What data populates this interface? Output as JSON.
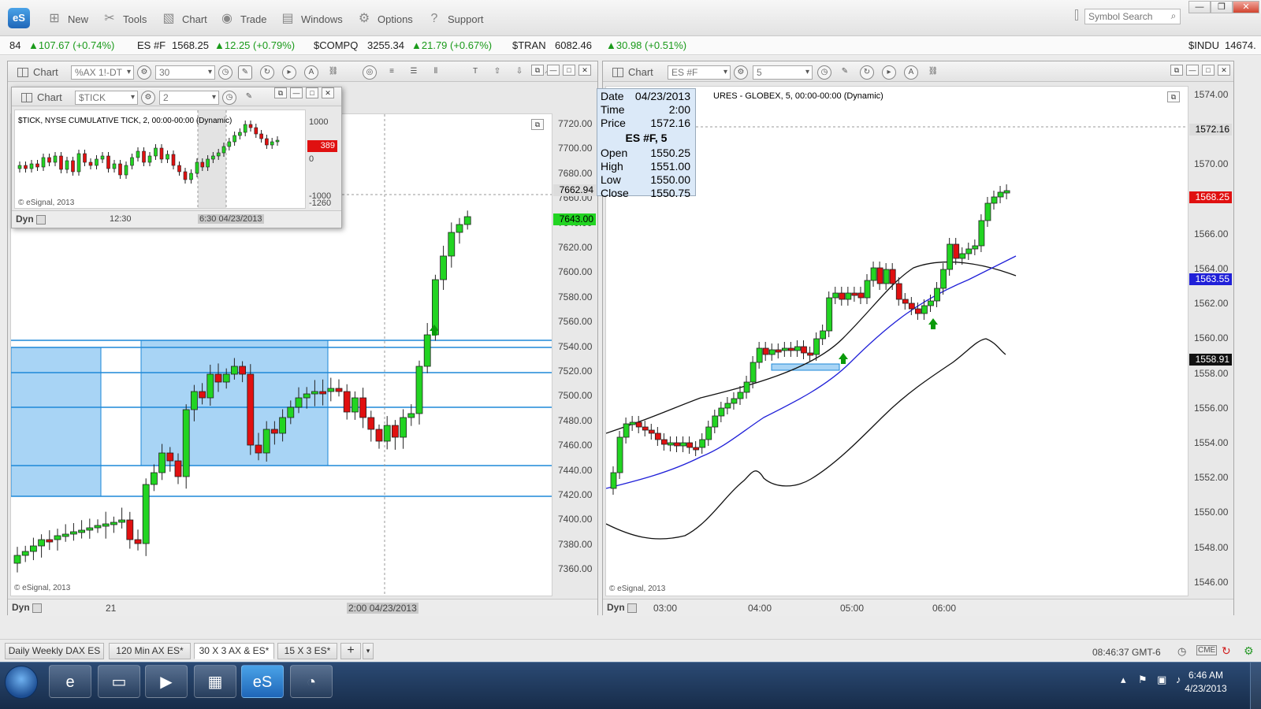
{
  "app": {
    "logo": "eS",
    "menu": [
      {
        "label": "New",
        "icon": "new-chart-icon"
      },
      {
        "label": "Tools",
        "icon": "tools-icon"
      },
      {
        "label": "Chart",
        "icon": "chart-icon"
      },
      {
        "label": "Trade",
        "icon": "trade-icon"
      },
      {
        "label": "Windows",
        "icon": "windows-icon"
      },
      {
        "label": "Options",
        "icon": "gear-icon"
      },
      {
        "label": "Support",
        "icon": "help-icon"
      }
    ],
    "search_placeholder": "Symbol Search"
  },
  "ticker": [
    {
      "symbol": "",
      "price": "84",
      "change": "▲107.67 (+0.74%)"
    },
    {
      "symbol": "ES #F",
      "price": "1568.25",
      "change": "▲12.25 (+0.79%)"
    },
    {
      "symbol": "$COMPQ",
      "price": "3255.34",
      "change": "▲21.79 (+0.67%)"
    },
    {
      "symbol": "$TRAN",
      "price": "6082.46",
      "change": "▲30.98 (+0.51%)"
    },
    {
      "symbol": "$INDU",
      "price": "14674.",
      "change": ""
    }
  ],
  "left_chart": {
    "title": "Chart",
    "symbol": "%AX 1!-DT",
    "interval": "30",
    "price_axis": [
      "7720.00",
      "7700.00",
      "7680.00",
      "7660.00",
      "7640.00",
      "7620.00",
      "7600.00",
      "7580.00",
      "7560.00",
      "7540.00",
      "7520.00",
      "7500.00",
      "7480.00",
      "7460.00",
      "7440.00",
      "7420.00",
      "7400.00",
      "7380.00",
      "7360.00"
    ],
    "last_price": "7643.00",
    "cursor_price": "7662.94",
    "time_labels": [
      "21"
    ],
    "cursor_time": "2:00 04/23/2013",
    "copyright": "© eSignal, 2013",
    "dyn": "Dyn"
  },
  "tick_chart": {
    "title": "Chart",
    "symbol": "$TICK",
    "interval": "2",
    "caption": "$TICK, NYSE CUMULATIVE TICK, 2, 00:00-00:00 (Dynamic)",
    "axis": [
      "1000",
      "0",
      "-1000"
    ],
    "last_value": "389",
    "low_value": "-1260",
    "time_labels": [
      "12:30"
    ],
    "cursor_time": "6:30 04/23/2013",
    "copyright": "© eSignal, 2013",
    "dyn": "Dyn"
  },
  "right_chart": {
    "title": "Chart",
    "symbol": "ES #F",
    "interval": "5",
    "caption": "URES - GLOBEX, 5, 00:00-00:00 (Dynamic)",
    "price_axis": [
      "1574.00",
      "1572.00",
      "1570.00",
      "1568.00",
      "1566.00",
      "1564.00",
      "1562.00",
      "1560.00",
      "1558.00",
      "1556.00",
      "1554.00",
      "1552.00",
      "1550.00",
      "1548.00",
      "1546.00"
    ],
    "cursor_price": "1572.16",
    "last_price": "1568.25",
    "ma_price": "1563.55",
    "lower_band": "1558.91",
    "time_labels": [
      "03:00",
      "04:00",
      "05:00",
      "06:00"
    ],
    "copyright": "© eSignal, 2013",
    "dyn": "Dyn"
  },
  "data_window": {
    "date_k": "Date",
    "date_v": "04/23/2013",
    "time_k": "Time",
    "time_v": "2:00",
    "price_k": "Price",
    "price_v": "1572.16",
    "header": "ES #F, 5",
    "open_k": "Open",
    "open_v": "1550.25",
    "high_k": "High",
    "high_v": "1551.00",
    "low_k": "Low",
    "low_v": "1550.00",
    "close_k": "Close",
    "close_v": "1550.75"
  },
  "tabs": [
    "Daily Weekly DAX ES",
    "120 Min AX ES*",
    "30 X 3 AX & ES*",
    "15 X 3 ES*"
  ],
  "active_tab": "30 X 3 AX & ES*",
  "status_time": "08:46:37 GMT-6",
  "clock": {
    "time": "6:46 AM",
    "date": "4/23/2013"
  },
  "colors": {
    "up": "#22d422",
    "down": "#e01010",
    "zone": "#a8d4f5",
    "zone_line": "#1e88d8",
    "ma": "#2020d8"
  }
}
